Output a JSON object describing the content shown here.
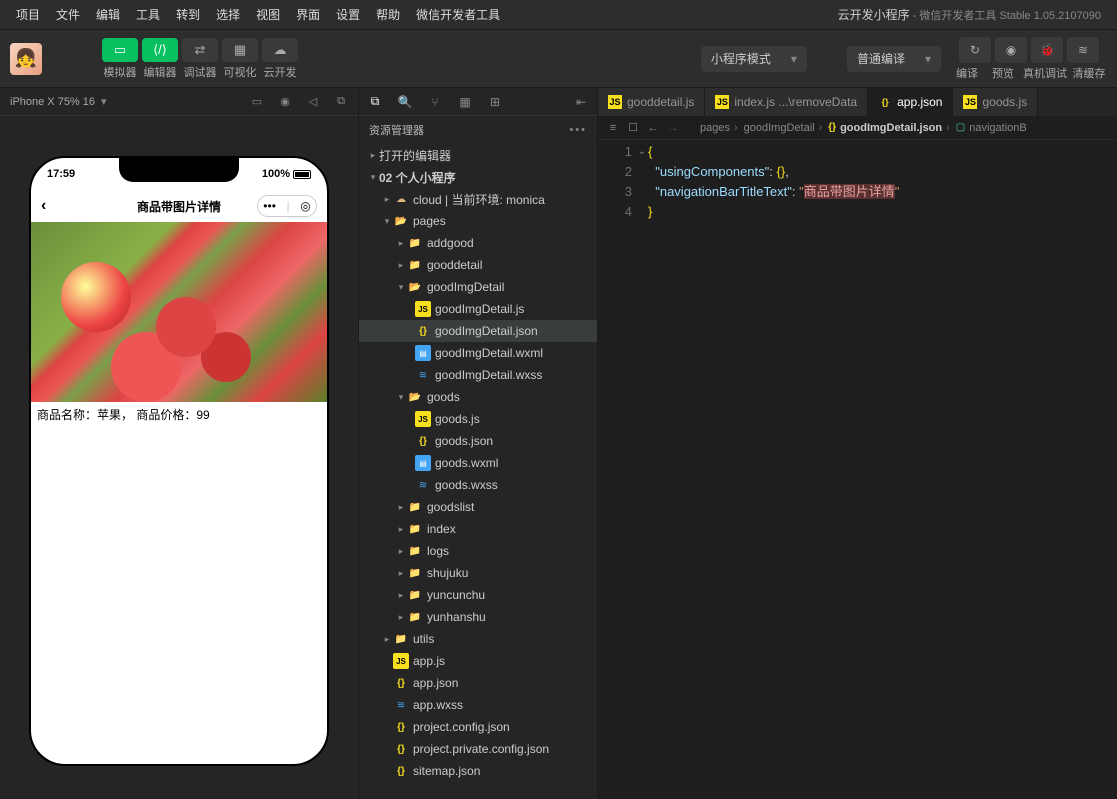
{
  "menubar": {
    "items": [
      "项目",
      "文件",
      "编辑",
      "工具",
      "转到",
      "选择",
      "视图",
      "界面",
      "设置",
      "帮助",
      "微信开发者工具"
    ],
    "title_main": "云开发小程序",
    "title_sub": " - 微信开发者工具 Stable 1.05.2107090"
  },
  "toolbar": {
    "labels": {
      "simulator": "模拟器",
      "editor": "编辑器",
      "debugger": "调试器",
      "visual": "可视化",
      "clouddev": "云开发"
    },
    "dropdown_mode": "小程序模式",
    "dropdown_compile": "普通编译",
    "right_labels": {
      "compile": "编译",
      "preview": "预览",
      "realdev": "真机调试",
      "clearcache": "清缓存"
    }
  },
  "simulator": {
    "device_info": "iPhone X 75% 16",
    "status_time": "17:59",
    "status_battery": "100%",
    "nav_title": "商品带图片详情",
    "product_text": "商品名称：苹果，  商品价格：99"
  },
  "explorer": {
    "title": "资源管理器",
    "section_opened": "打开的编辑器",
    "project_root": "02 个人小程序",
    "cloud_label": "cloud | 当前环境: monica",
    "pages": "pages",
    "folders": {
      "addgood": "addgood",
      "gooddetail": "gooddetail",
      "goodImgDetail": "goodImgDetail",
      "goods": "goods",
      "goodslist": "goodslist",
      "index": "index",
      "logs": "logs",
      "shujuku": "shujuku",
      "yuncunchu": "yuncunchu",
      "yunhanshu": "yunhanshu",
      "utils": "utils"
    },
    "files": {
      "goodImgDetail_js": "goodImgDetail.js",
      "goodImgDetail_json": "goodImgDetail.json",
      "goodImgDetail_wxml": "goodImgDetail.wxml",
      "goodImgDetail_wxss": "goodImgDetail.wxss",
      "goods_js": "goods.js",
      "goods_json": "goods.json",
      "goods_wxml": "goods.wxml",
      "goods_wxss": "goods.wxss",
      "app_js": "app.js",
      "app_json": "app.json",
      "app_wxss": "app.wxss",
      "project_config": "project.config.json",
      "project_private": "project.private.config.json",
      "sitemap": "sitemap.json"
    }
  },
  "editor": {
    "tabs": [
      {
        "icon": "js",
        "label": "gooddetail.js"
      },
      {
        "icon": "js",
        "label": "index.js ...\\removeData"
      },
      {
        "icon": "json",
        "label": "app.json",
        "active": true
      },
      {
        "icon": "js",
        "label": "goods.js"
      }
    ],
    "breadcrumb": {
      "p1": "pages",
      "p2": "goodImgDetail",
      "p3": "goodImgDetail.json",
      "p4": "navigationB"
    },
    "code": {
      "line1_a": "{",
      "line2_key": "\"usingComponents\"",
      "line2_val": "{}",
      "line3_key": "\"navigationBarTitleText\"",
      "line3_val": "\"商品带图片详情\"",
      "line4_a": "}"
    }
  }
}
